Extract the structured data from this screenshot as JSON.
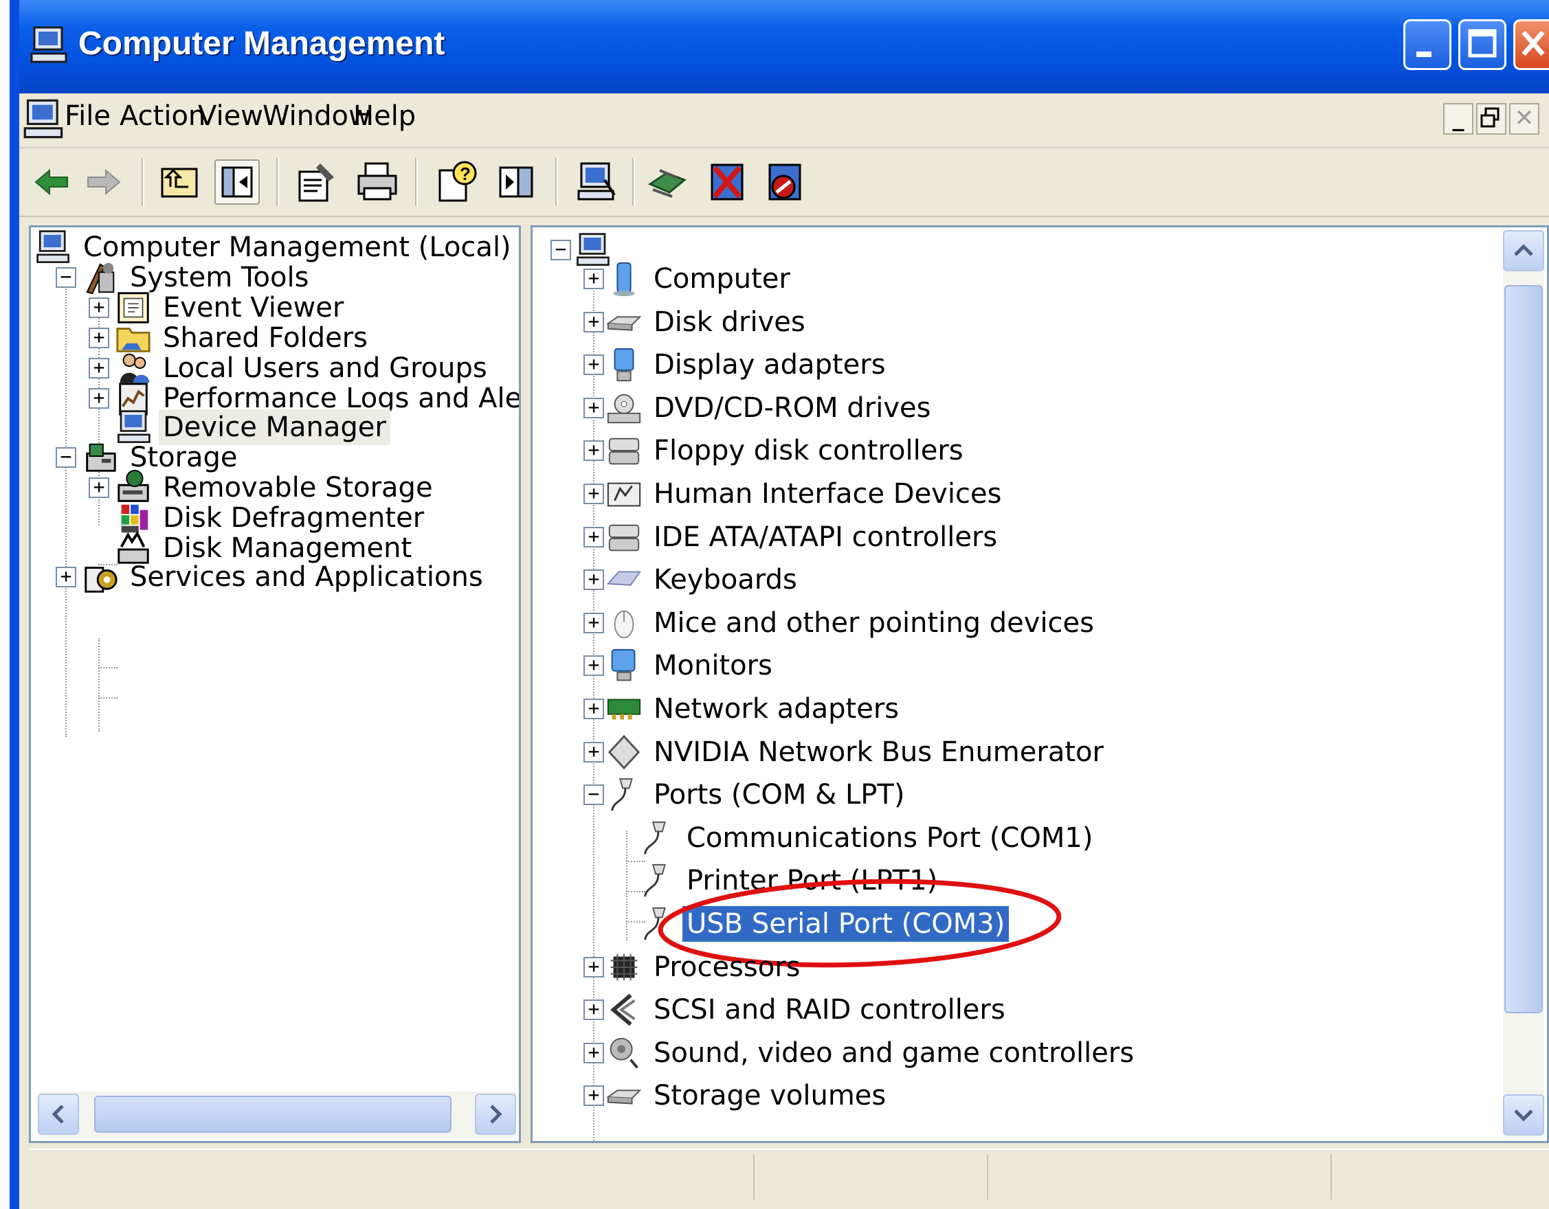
{
  "window": {
    "title": "Computer Management",
    "controls": {
      "minimize": "_",
      "maximize": "□",
      "close": "✕"
    }
  },
  "menu": {
    "items": [
      "File",
      "Action",
      "View",
      "Window",
      "Help"
    ],
    "mdi_controls": {
      "minimize": "_",
      "restore": "🗗",
      "close": "✕"
    }
  },
  "toolbar": {
    "buttons": [
      "back-icon",
      "forward-icon",
      "up-one-level-icon",
      "show-hide-tree-icon",
      "properties-icon",
      "print-icon",
      "help-icon",
      "show-hide-action-pane-icon",
      "computer-properties-icon",
      "scan-hardware-icon",
      "uninstall-icon",
      "disable-icon"
    ]
  },
  "left_tree": {
    "root": "Computer Management (Local)",
    "system_tools": "System Tools",
    "event_viewer": "Event Viewer",
    "shared_folders": "Shared Folders",
    "local_users": "Local Users and Groups",
    "perf_logs": "Performance Logs and Alert:",
    "device_manager": "Device Manager",
    "storage": "Storage",
    "removable_storage": "Removable Storage",
    "disk_defrag": "Disk Defragmenter",
    "disk_mgmt": "Disk Management",
    "services_apps": "Services and Applications"
  },
  "device_tree": {
    "computer": "Computer",
    "disk_drives": "Disk drives",
    "display_adapters": "Display adapters",
    "dvd": "DVD/CD-ROM drives",
    "floppy": "Floppy disk controllers",
    "hid": "Human Interface Devices",
    "ide": "IDE ATA/ATAPI controllers",
    "keyboards": "Keyboards",
    "mice": "Mice and other pointing devices",
    "monitors": "Monitors",
    "network": "Network adapters",
    "nvidia": "NVIDIA Network Bus Enumerator",
    "ports": "Ports (COM & LPT)",
    "com1": "Communications Port (COM1)",
    "lpt1": "Printer Port (LPT1)",
    "usb_serial": "USB Serial Port (COM3)",
    "processors": "Processors",
    "scsi": "SCSI and RAID controllers",
    "sound": "Sound, video and game controllers",
    "storage_volumes": "Storage volumes"
  },
  "colors": {
    "selection": "#316ac5",
    "highlight_circle": "#e01010",
    "title_blue": "#0350dc"
  }
}
